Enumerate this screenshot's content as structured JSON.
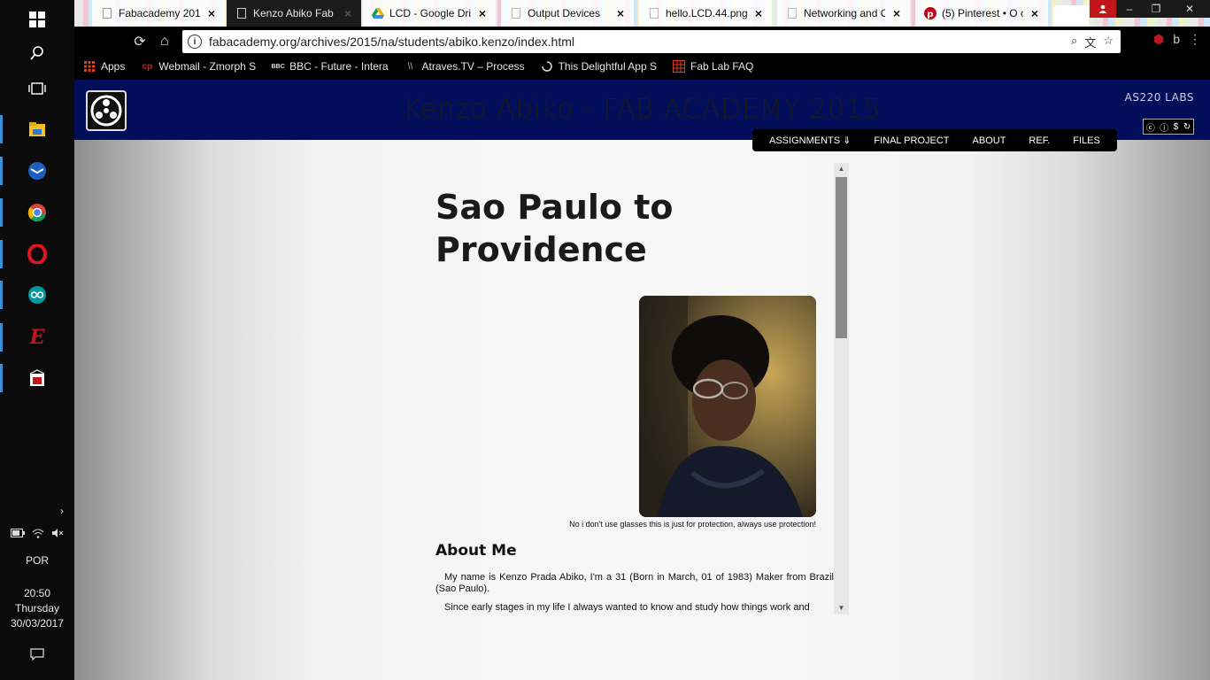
{
  "taskbar": {
    "language": "POR",
    "time": "20:50",
    "day": "Thursday",
    "date": "30/03/2017"
  },
  "browser": {
    "tabs": [
      {
        "title": "Fabacademy 2015",
        "icon": "page-icon",
        "active": false
      },
      {
        "title": "Kenzo Abiko Fab",
        "icon": "page-icon",
        "active": true
      },
      {
        "title": "LCD - Google Dri",
        "icon": "google-drive-icon",
        "active": false
      },
      {
        "title": "Output Devices",
        "icon": "page-icon",
        "active": false
      },
      {
        "title": "hello.LCD.44.png",
        "icon": "image-icon",
        "active": false
      },
      {
        "title": "Networking and C",
        "icon": "page-icon",
        "active": false
      },
      {
        "title": "(5) Pinterest • O c",
        "icon": "pinterest-icon",
        "active": false
      }
    ],
    "url": "fabacademy.org/archives/2015/na/students/abiko.kenzo/index.html",
    "bookmarks": [
      {
        "label": "Apps",
        "icon": "apps-grid-icon"
      },
      {
        "label": "Webmail - Zmorph S",
        "icon": "zmorph-icon"
      },
      {
        "label": "BBC - Future - Intera",
        "icon": "bbc-icon"
      },
      {
        "label": "Atraves.TV – Process",
        "icon": "atraves-icon"
      },
      {
        "label": "This Delightful App S",
        "icon": "loading-icon"
      },
      {
        "label": "Fab Lab FAQ",
        "icon": "fablab-icon"
      }
    ]
  },
  "site": {
    "title": "Kenzo Abiko - FAB ACADEMY 2015",
    "lab_badge": "AS220 LABS",
    "nav": [
      "ASSIGNMENTS ⇓",
      "FINAL PROJECT",
      "ABOUT",
      "REF.",
      "FILES"
    ],
    "colors": {
      "header": "#020e5a",
      "nav": "#000000"
    }
  },
  "content": {
    "page_title": "Sao Paulo to Providence",
    "photo_caption": "No i don't use glasses this is just for protection, always use protection!",
    "about_heading": "About Me",
    "para1": "My name is Kenzo Prada Abiko, I'm a 31 (Born in March, 01 of 1983) Maker from Brazil (Sao Paulo).",
    "para2": "Since early stages in my life I always wanted to know and study how things work and"
  }
}
